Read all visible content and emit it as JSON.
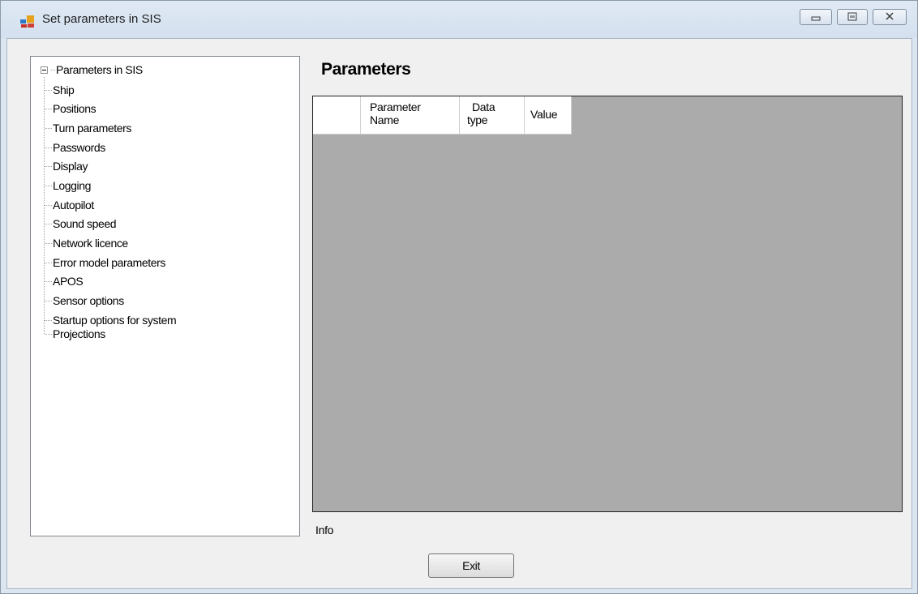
{
  "window": {
    "title": "Set parameters in SIS"
  },
  "tree": {
    "root": "Parameters in SIS",
    "items": [
      "Ship",
      "Positions",
      "Turn parameters",
      "Passwords",
      "Display",
      "Logging",
      "Autopilot",
      "Sound speed",
      "Network licence",
      "Error model parameters",
      "APOS",
      "Sensor options",
      "Startup options for system",
      "Projections"
    ]
  },
  "main": {
    "heading": "Parameters",
    "grid": {
      "columns": [
        {
          "line1": "Parameter",
          "line2": "Name"
        },
        {
          "line1": "Data",
          "line2": "type"
        },
        {
          "line1": "Value",
          "line2": ""
        }
      ]
    },
    "info_label": "Info"
  },
  "buttons": {
    "exit_label": "Exit"
  },
  "icons": {
    "app": "app-window-icon",
    "minimize": "minimize-icon",
    "maximize": "maximize-icon",
    "close": "close-icon",
    "collapse": "tree-collapse-icon"
  },
  "colors": {
    "title_bar": "#dbe6f1",
    "grid_background": "#ababab",
    "client": "#f0f0f0"
  }
}
